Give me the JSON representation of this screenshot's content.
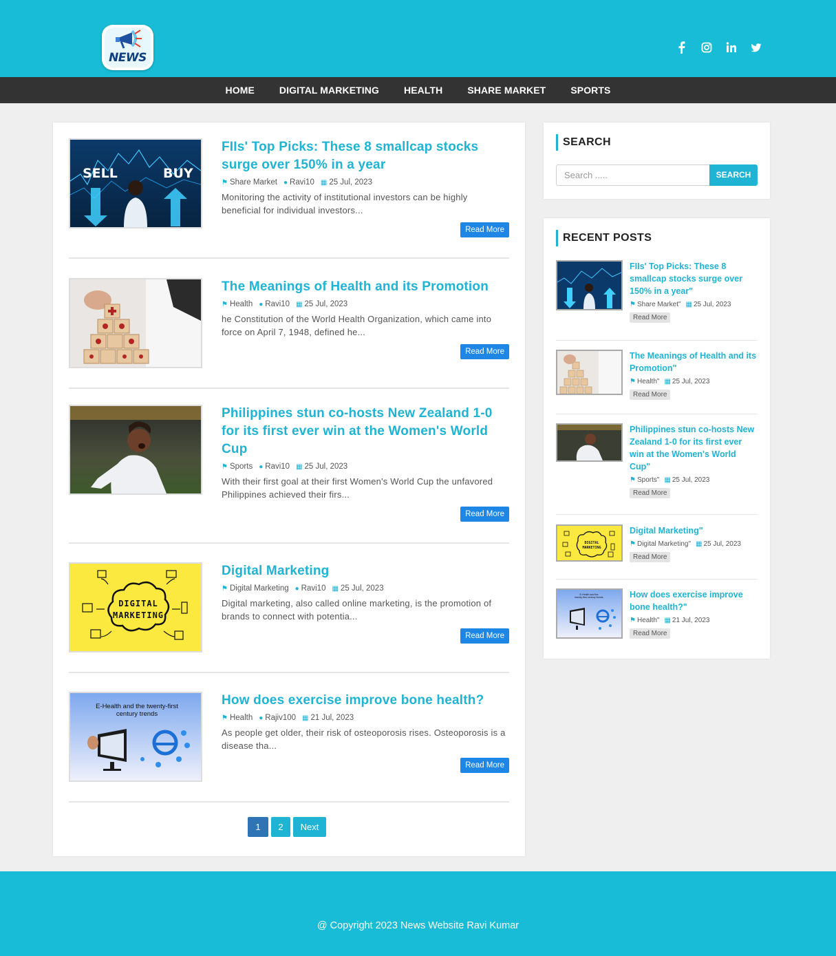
{
  "brand": {
    "logo_text": "NEWS"
  },
  "social": [
    "facebook-icon",
    "instagram-icon",
    "linkedin-icon",
    "twitter-icon"
  ],
  "nav": [
    "HOME",
    "DIGITAL MARKETING",
    "HEALTH",
    "SHARE MARKET",
    "SPORTS"
  ],
  "posts": [
    {
      "title": "FIIs' Top Picks: These 8 smallcap stocks surge over 150% in a year",
      "category": "Share Market",
      "author": "Ravi10",
      "date": "25 Jul, 2023",
      "excerpt": "Monitoring the activity of institutional investors can be highly beneficial for individual investors...",
      "read_more": "Read More",
      "thumb_text": [
        "SELL",
        "BUY"
      ]
    },
    {
      "title": "The Meanings of Health and its Promotion",
      "category": "Health",
      "author": "Ravi10",
      "date": "25 Jul, 2023",
      "excerpt": "he Constitution of the World Health Organization, which came into force on April 7, 1948, defined he...",
      "read_more": "Read More"
    },
    {
      "title": "Philippines stun co-hosts New Zealand 1-0 for its first ever win at the Women's World Cup",
      "category": "Sports",
      "author": "Ravi10",
      "date": "25 Jul, 2023",
      "excerpt": "With their first goal at their first Women's World Cup the unfavored Philippines achieved their firs...",
      "read_more": "Read More"
    },
    {
      "title": "Digital Marketing",
      "category": "Digital Marketing",
      "author": "Ravi10",
      "date": "25 Jul, 2023",
      "excerpt": "Digital marketing, also called online marketing, is the promotion of brands to connect with potentia...",
      "read_more": "Read More",
      "thumb_text": "DIGITAL MARKETING"
    },
    {
      "title": "How does exercise improve bone health?",
      "category": "Health",
      "author": "Rajiv100",
      "date": "21 Jul, 2023",
      "excerpt": "As people get older, their risk of osteoporosis rises. Osteoporosis is a disease tha...",
      "read_more": "Read More",
      "thumb_text": "E-Health and the twenty-first century trends"
    }
  ],
  "pagination": {
    "page1": "1",
    "page2": "2",
    "next": "Next"
  },
  "search": {
    "title": "SEARCH",
    "placeholder": "Search .....",
    "button": "SEARCH"
  },
  "recent": {
    "title": "RECENT POSTS",
    "items": [
      {
        "title": "FIIs' Top Picks: These 8 smallcap stocks surge over 150% in a year\"",
        "category": "Share Market\"",
        "date": "25 Jul, 2023",
        "read_more": "Read More"
      },
      {
        "title": "The Meanings of Health and its Promotion\"",
        "category": "Health\"",
        "date": "25 Jul, 2023",
        "read_more": "Read More"
      },
      {
        "title": "Philippines stun co-hosts New Zealand 1-0 for its first ever win at the Women's World Cup\"",
        "category": "Sports\"",
        "date": "25 Jul, 2023",
        "read_more": "Read More"
      },
      {
        "title": "Digital Marketing\"",
        "category": "Digital Marketing\"",
        "date": "25 Jul, 2023",
        "read_more": "Read More"
      },
      {
        "title": "How does exercise improve bone health?\"",
        "category": "Health\"",
        "date": "21 Jul, 2023",
        "read_more": "Read More"
      }
    ]
  },
  "footer": {
    "copyright": "@ Copyright 2023 News Website Ravi Kumar"
  },
  "colors": {
    "primary": "#18bcd6",
    "title": "#1fb3d4",
    "button": "#1e87e5",
    "nav": "#333333"
  }
}
